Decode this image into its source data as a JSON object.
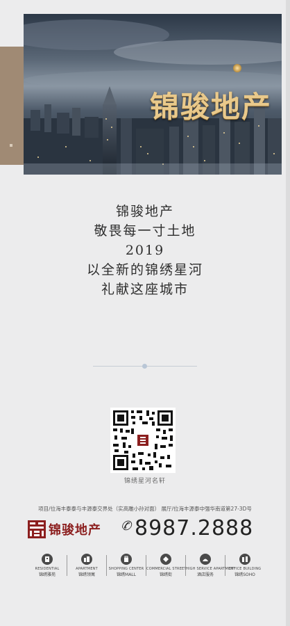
{
  "hero": {
    "title": "锦骏地产"
  },
  "poem": {
    "lines": [
      "锦骏地产",
      "敬畏每一寸土地",
      "2019",
      "以全新的锦绣星河",
      "礼献这座城市"
    ]
  },
  "qr": {
    "caption": "锦绣星河名轩",
    "center_label": "锦绣"
  },
  "contact": {
    "address": "项目/位海丰泰泰与丰源泰交界处（实高雕小孙对面）  展厅/位海丰源泰中强华南道第27-3D号",
    "brand_name": "锦骏地产",
    "phone_icon": "✆",
    "phone": "8987.2888"
  },
  "features": [
    {
      "icon": "residence-icon",
      "en": "RESIDENTIAL",
      "cn": "锦绣雅苑"
    },
    {
      "icon": "apartment-icon",
      "en": "APARTMENT",
      "cn": "锦绣领寓"
    },
    {
      "icon": "shopping-icon",
      "en": "SHOPPING CENTER",
      "cn": "锦绣MALL"
    },
    {
      "icon": "street-icon",
      "en": "COMMERCIAL STREET",
      "cn": "锦绣街"
    },
    {
      "icon": "hotel-icon",
      "en": "HIGH SERVICE APARTMENT",
      "cn": "酒店服务"
    },
    {
      "icon": "office-icon",
      "en": "OFFICE BUILDING",
      "cn": "锦绣SOHO"
    }
  ],
  "colors": {
    "accent_gold": "#e9c98b",
    "brand_red": "#8c1f1f",
    "side_tab": "#a08a74",
    "background": "#ececed"
  }
}
